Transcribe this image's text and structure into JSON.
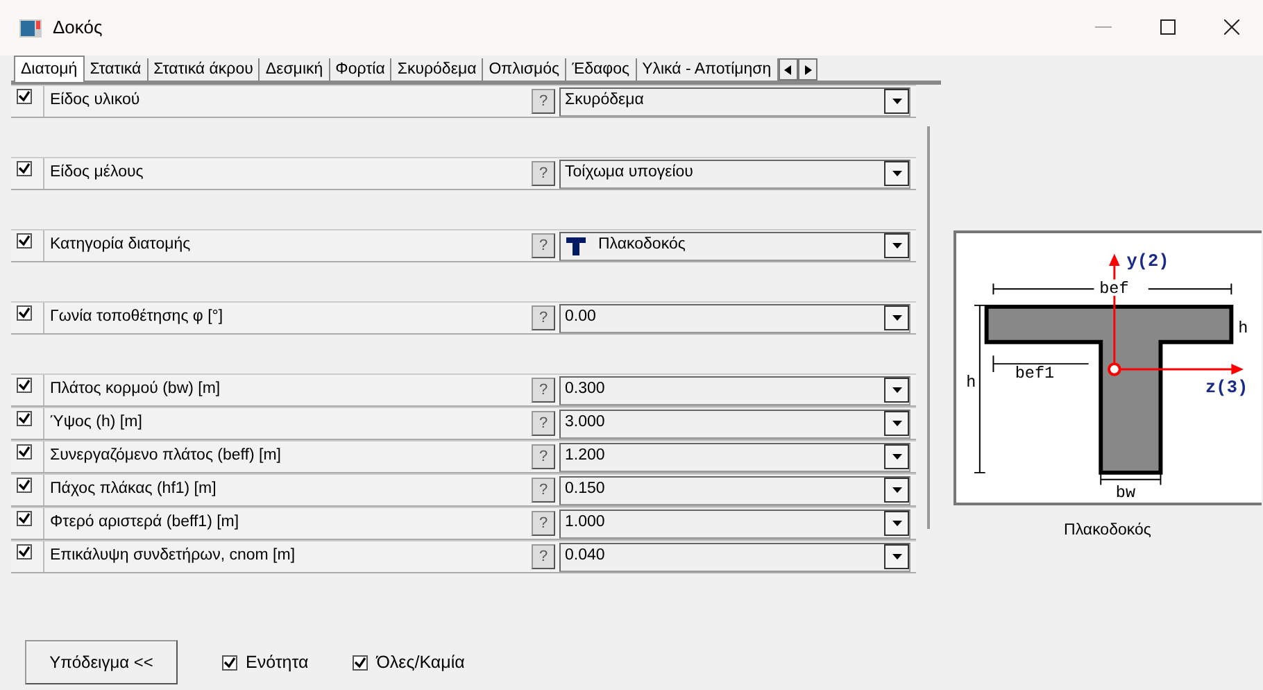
{
  "window": {
    "title": "Δοκός"
  },
  "tabs": [
    {
      "label": "Διατομή",
      "selected": true
    },
    {
      "label": "Στατικά",
      "selected": false
    },
    {
      "label": "Στατικά άκρου",
      "selected": false
    },
    {
      "label": "Δεσμική",
      "selected": false
    },
    {
      "label": "Φορτία",
      "selected": false
    },
    {
      "label": "Σκυρόδεμα",
      "selected": false
    },
    {
      "label": "Οπλισμός",
      "selected": false
    },
    {
      "label": "Έδαφος",
      "selected": false
    },
    {
      "label": "Υλικά - Αποτίμηση",
      "selected": false
    }
  ],
  "groups": [
    {
      "rows": [
        {
          "label": "Είδος υλικού",
          "help": "?",
          "value": "Σκυρόδεμα",
          "checked": true
        }
      ]
    },
    {
      "rows": [
        {
          "label": "Είδος μέλους",
          "help": "?",
          "value": "Τοίχωμα υπογείου",
          "checked": true
        }
      ]
    },
    {
      "rows": [
        {
          "label": "Κατηγορία διατομής",
          "help": "?",
          "value": "Πλακοδοκός",
          "checked": true,
          "kind": "icon"
        }
      ]
    },
    {
      "rows": [
        {
          "label": "Γωνία τοποθέτησης φ [°]",
          "help": "?",
          "value": "0.00",
          "checked": true
        }
      ]
    },
    {
      "rows": [
        {
          "label": "Πλάτος κορμού (bw) [m]",
          "help": "?",
          "value": "0.300",
          "checked": true
        },
        {
          "label": "Ύψος (h) [m]",
          "help": "?",
          "value": "3.000",
          "checked": true
        },
        {
          "label": "Συνεργαζόμενο πλάτος (beff) [m]",
          "help": "?",
          "value": "1.200",
          "checked": true
        },
        {
          "label": "Πάχος πλάκας (hf1) [m]",
          "help": "?",
          "value": "0.150",
          "checked": true
        },
        {
          "label": "Φτερό αριστερά (beff1) [m]",
          "help": "?",
          "value": "1.000",
          "checked": true
        },
        {
          "label": "Επικάλυψη συνδετήρων, cnom [m]",
          "help": "?",
          "value": "0.040",
          "checked": true
        }
      ]
    }
  ],
  "diagram": {
    "labels": {
      "y_axis": "y(2)",
      "z_axis": "z(3)",
      "bef": "bef",
      "bef1": "bef1",
      "h": "h",
      "hf": "h",
      "bw": "bw"
    },
    "caption": "Πλακοδοκός"
  },
  "footer": {
    "button": "Υπόδειγμα <<",
    "checks": [
      {
        "label": "Ενότητα",
        "checked": true
      },
      {
        "label": "Όλες/Καμία",
        "checked": true
      }
    ]
  }
}
